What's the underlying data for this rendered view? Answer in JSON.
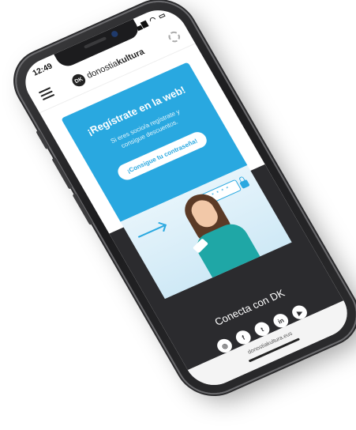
{
  "status_bar": {
    "time": "12:49",
    "icons": "▂▄▆ ◠ ▭"
  },
  "header": {
    "logo_badge": "DK",
    "logo_prefix": "donostia",
    "logo_suffix": "kultura"
  },
  "promo": {
    "title": "¡Regístrate en la web!",
    "subtitle": "Si eres socio/a regístrate y consigue descuentos.",
    "button_label": "¡Consigue tu contraseña!",
    "password_mask": "* * * *"
  },
  "footer": {
    "title": "Conecta con DK",
    "socials": [
      {
        "name": "instagram",
        "glyph": "◎"
      },
      {
        "name": "facebook",
        "glyph": "f"
      },
      {
        "name": "twitter",
        "glyph": "t"
      },
      {
        "name": "linkedin",
        "glyph": "in"
      },
      {
        "name": "youtube",
        "glyph": "▶"
      }
    ]
  },
  "browser": {
    "url": "donostiakultura.eus"
  },
  "colors": {
    "accent": "#29a8e0",
    "footer_bg": "#2b2b2e"
  }
}
